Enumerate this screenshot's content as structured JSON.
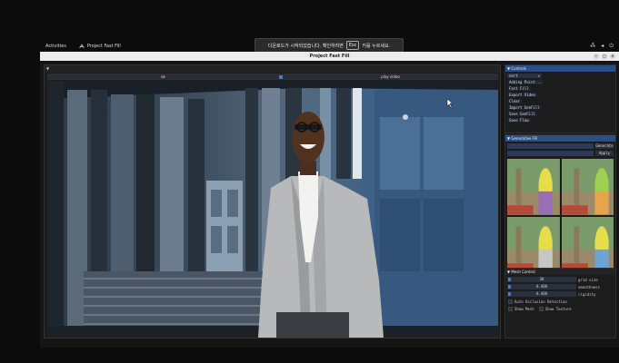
{
  "topbar": {
    "activities": "Activities",
    "app_name": "Project Fast Fill"
  },
  "toast": {
    "before": "다운로드가 시작되었습니다. 확인하려면",
    "key": "Esc",
    "after": "키를 누르세요."
  },
  "window": {
    "title": "Project Fast Fill"
  },
  "viewer": {
    "toolbar_left": "ok",
    "toolbar_right": "play video"
  },
  "controls": {
    "title": "Controls",
    "select_value": "sort",
    "items": [
      "Adding Point...",
      "Fast Fill",
      "Export Video",
      "Clear",
      "Import GenFill",
      "Save GenFill",
      "Save Flow"
    ]
  },
  "generative_fill": {
    "title": "Generative Fill",
    "generate_label": "Generate",
    "apply_label": "Apply"
  },
  "mesh_control": {
    "title": "Mesh Control",
    "sliders": [
      {
        "value": "30",
        "label": "grid size"
      },
      {
        "value": "0.400",
        "label": "smoothness"
      },
      {
        "value": "0.400",
        "label": "rigidity"
      }
    ],
    "checkboxes": [
      {
        "label": "Auto Occlusion Detection"
      },
      {
        "label": "Show Mesh"
      },
      {
        "label": "Show Texture"
      }
    ]
  }
}
